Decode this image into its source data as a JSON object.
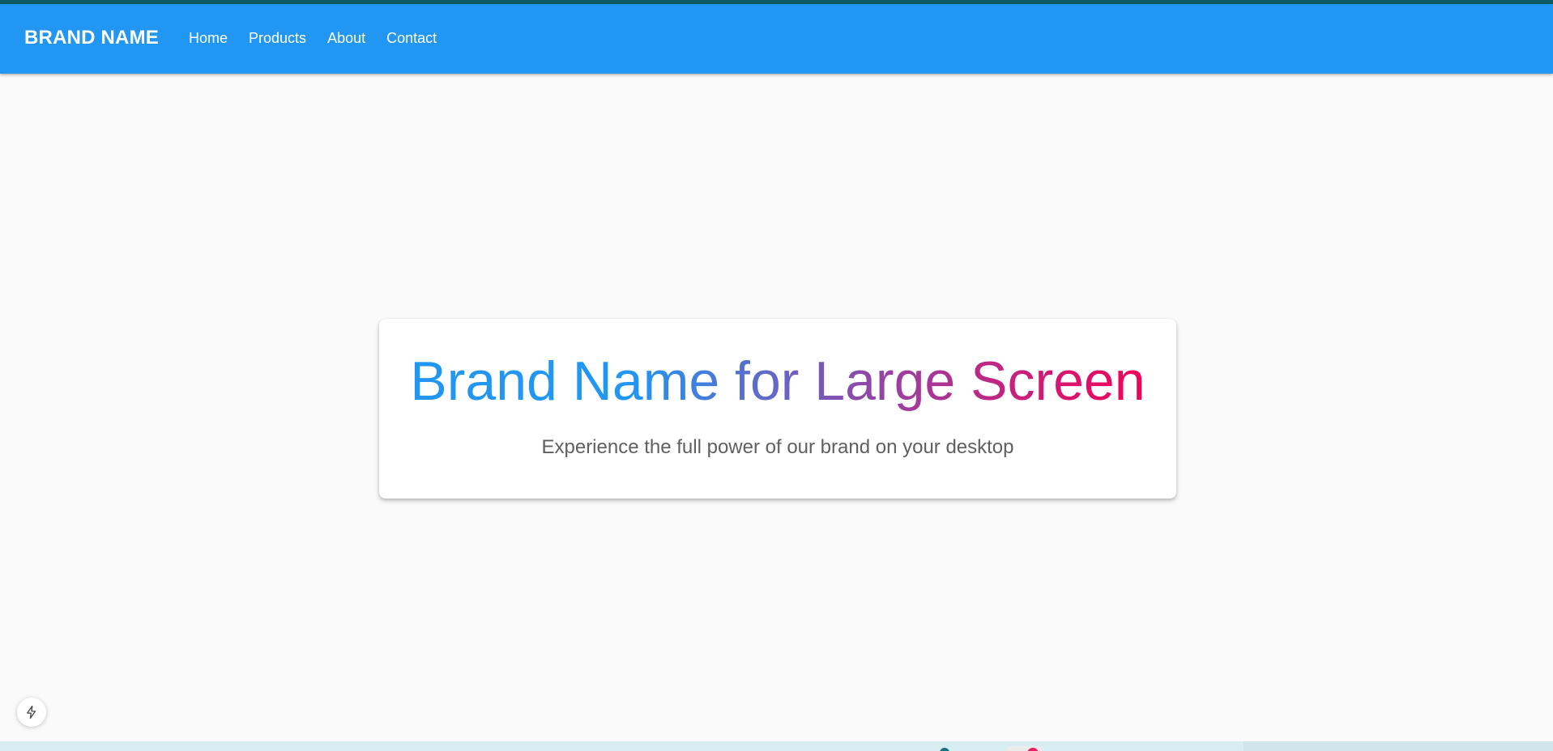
{
  "header": {
    "brand": "BRAND NAME",
    "nav": [
      {
        "label": "Home"
      },
      {
        "label": "Products"
      },
      {
        "label": "About"
      },
      {
        "label": "Contact"
      }
    ]
  },
  "hero": {
    "title": "Brand Name for Large Screen",
    "subtitle": "Experience the full power of our brand on your desktop"
  },
  "floating_button": {
    "icon": "lightning-bolt-icon"
  },
  "colors": {
    "app_bar": "#2196f3",
    "top_strip": "#0f5d63",
    "page_background": "#fafafa",
    "title_gradient_start": "#2196f3",
    "title_gradient_mid": "#9c3fa0",
    "title_gradient_end": "#f50057",
    "subtitle_text": "#5f5f5f"
  }
}
